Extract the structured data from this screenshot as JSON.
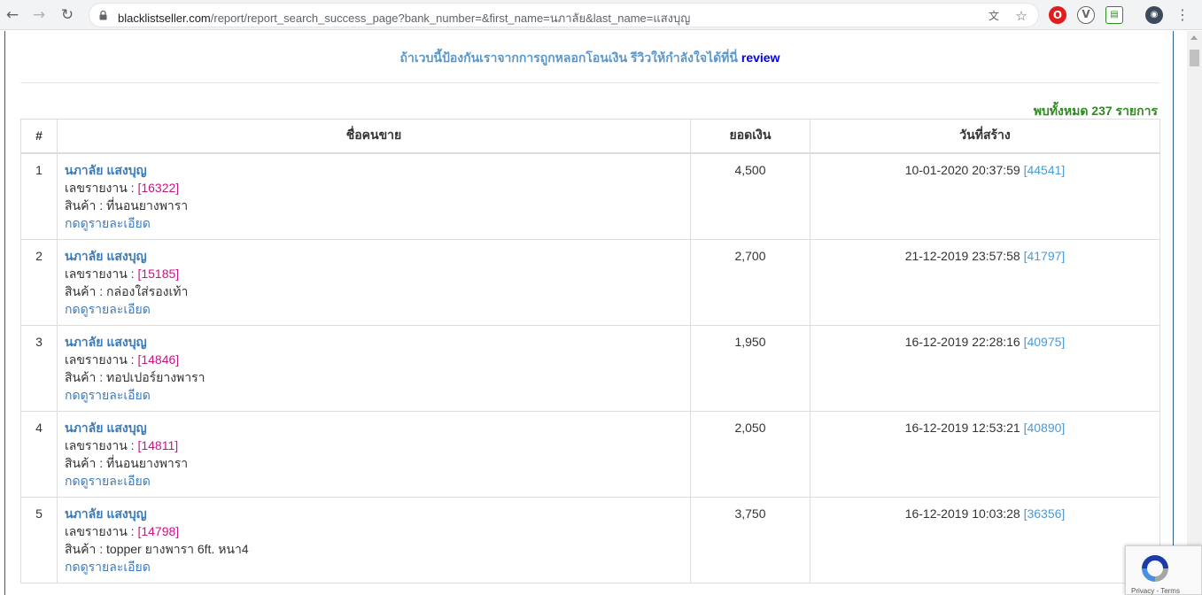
{
  "browser": {
    "url_domain": "blacklistseller.com",
    "url_path": "/report/report_search_success_page?bank_number=&first_name=นภาลัย&last_name=แสงบุญ"
  },
  "promo": {
    "text": "ถ้าเวบนี้ป้องกันเราจากการถูกหลอกโอนเงิน รีวิวให้กำลังใจได้ที่นี่",
    "link": "review"
  },
  "found_count": "พบทั้งหมด 237 รายการ",
  "table": {
    "headers": [
      "#",
      "ชื่อคนขาย",
      "ยอดเงิน",
      "วันที่สร้าง"
    ],
    "report_label": "เลขรายงาน :",
    "product_label": "สินค้า :",
    "detail_label": "กดดูรายละเอียด",
    "rows": [
      {
        "num": "1",
        "seller": "นภาลัย แสงบุญ",
        "report_id": "[16322]",
        "product": "ที่นอนยางพารา",
        "amount": "4,500",
        "date": "10-01-2020 20:37:59",
        "ref": "[44541]"
      },
      {
        "num": "2",
        "seller": "นภาลัย แสงบุญ",
        "report_id": "[15185]",
        "product": "กล่องใส่รองเท้า",
        "amount": "2,700",
        "date": "21-12-2019 23:57:58",
        "ref": "[41797]"
      },
      {
        "num": "3",
        "seller": "นภาลัย แสงบุญ",
        "report_id": "[14846]",
        "product": "ทอปเปอร์ยางพารา",
        "amount": "1,950",
        "date": "16-12-2019 22:28:16",
        "ref": "[40975]"
      },
      {
        "num": "4",
        "seller": "นภาลัย แสงบุญ",
        "report_id": "[14811]",
        "product": "ที่นอนยางพารา",
        "amount": "2,050",
        "date": "16-12-2019 12:53:21",
        "ref": "[40890]"
      },
      {
        "num": "5",
        "seller": "นภาลัย แสงบุญ",
        "report_id": "[14798]",
        "product": "topper ยางพารา 6ft. หนา4",
        "amount": "3,750",
        "date": "16-12-2019 10:03:28",
        "ref": "[36356]"
      }
    ]
  },
  "recaptcha": {
    "text": "Privacy - Terms"
  },
  "colors": {
    "accent": "#3d7ab8",
    "found": "#2e8b1e",
    "report_id": "#c71585"
  }
}
